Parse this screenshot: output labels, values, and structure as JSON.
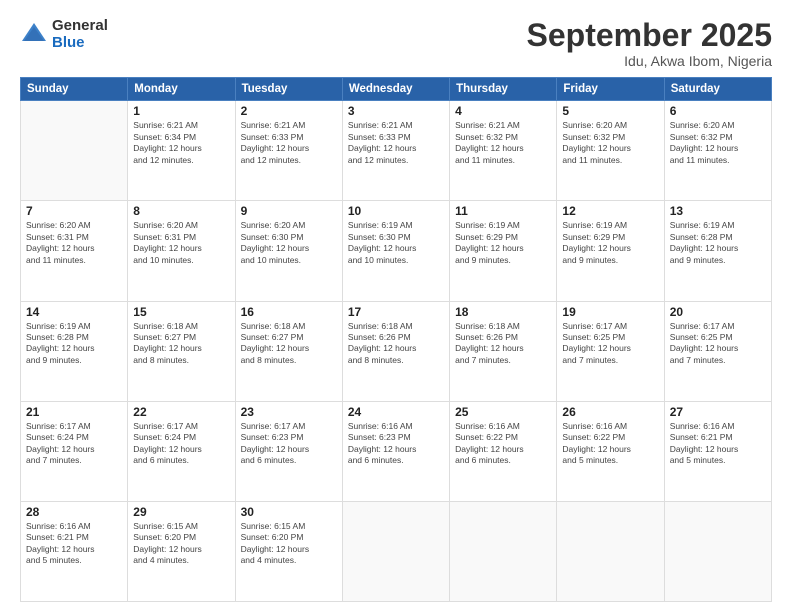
{
  "header": {
    "logo_general": "General",
    "logo_blue": "Blue",
    "month_title": "September 2025",
    "subtitle": "Idu, Akwa Ibom, Nigeria"
  },
  "weekdays": [
    "Sunday",
    "Monday",
    "Tuesday",
    "Wednesday",
    "Thursday",
    "Friday",
    "Saturday"
  ],
  "weeks": [
    [
      {
        "day": "",
        "info": ""
      },
      {
        "day": "1",
        "info": "Sunrise: 6:21 AM\nSunset: 6:34 PM\nDaylight: 12 hours\nand 12 minutes."
      },
      {
        "day": "2",
        "info": "Sunrise: 6:21 AM\nSunset: 6:33 PM\nDaylight: 12 hours\nand 12 minutes."
      },
      {
        "day": "3",
        "info": "Sunrise: 6:21 AM\nSunset: 6:33 PM\nDaylight: 12 hours\nand 12 minutes."
      },
      {
        "day": "4",
        "info": "Sunrise: 6:21 AM\nSunset: 6:32 PM\nDaylight: 12 hours\nand 11 minutes."
      },
      {
        "day": "5",
        "info": "Sunrise: 6:20 AM\nSunset: 6:32 PM\nDaylight: 12 hours\nand 11 minutes."
      },
      {
        "day": "6",
        "info": "Sunrise: 6:20 AM\nSunset: 6:32 PM\nDaylight: 12 hours\nand 11 minutes."
      }
    ],
    [
      {
        "day": "7",
        "info": "Sunrise: 6:20 AM\nSunset: 6:31 PM\nDaylight: 12 hours\nand 11 minutes."
      },
      {
        "day": "8",
        "info": "Sunrise: 6:20 AM\nSunset: 6:31 PM\nDaylight: 12 hours\nand 10 minutes."
      },
      {
        "day": "9",
        "info": "Sunrise: 6:20 AM\nSunset: 6:30 PM\nDaylight: 12 hours\nand 10 minutes."
      },
      {
        "day": "10",
        "info": "Sunrise: 6:19 AM\nSunset: 6:30 PM\nDaylight: 12 hours\nand 10 minutes."
      },
      {
        "day": "11",
        "info": "Sunrise: 6:19 AM\nSunset: 6:29 PM\nDaylight: 12 hours\nand 9 minutes."
      },
      {
        "day": "12",
        "info": "Sunrise: 6:19 AM\nSunset: 6:29 PM\nDaylight: 12 hours\nand 9 minutes."
      },
      {
        "day": "13",
        "info": "Sunrise: 6:19 AM\nSunset: 6:28 PM\nDaylight: 12 hours\nand 9 minutes."
      }
    ],
    [
      {
        "day": "14",
        "info": "Sunrise: 6:19 AM\nSunset: 6:28 PM\nDaylight: 12 hours\nand 9 minutes."
      },
      {
        "day": "15",
        "info": "Sunrise: 6:18 AM\nSunset: 6:27 PM\nDaylight: 12 hours\nand 8 minutes."
      },
      {
        "day": "16",
        "info": "Sunrise: 6:18 AM\nSunset: 6:27 PM\nDaylight: 12 hours\nand 8 minutes."
      },
      {
        "day": "17",
        "info": "Sunrise: 6:18 AM\nSunset: 6:26 PM\nDaylight: 12 hours\nand 8 minutes."
      },
      {
        "day": "18",
        "info": "Sunrise: 6:18 AM\nSunset: 6:26 PM\nDaylight: 12 hours\nand 7 minutes."
      },
      {
        "day": "19",
        "info": "Sunrise: 6:17 AM\nSunset: 6:25 PM\nDaylight: 12 hours\nand 7 minutes."
      },
      {
        "day": "20",
        "info": "Sunrise: 6:17 AM\nSunset: 6:25 PM\nDaylight: 12 hours\nand 7 minutes."
      }
    ],
    [
      {
        "day": "21",
        "info": "Sunrise: 6:17 AM\nSunset: 6:24 PM\nDaylight: 12 hours\nand 7 minutes."
      },
      {
        "day": "22",
        "info": "Sunrise: 6:17 AM\nSunset: 6:24 PM\nDaylight: 12 hours\nand 6 minutes."
      },
      {
        "day": "23",
        "info": "Sunrise: 6:17 AM\nSunset: 6:23 PM\nDaylight: 12 hours\nand 6 minutes."
      },
      {
        "day": "24",
        "info": "Sunrise: 6:16 AM\nSunset: 6:23 PM\nDaylight: 12 hours\nand 6 minutes."
      },
      {
        "day": "25",
        "info": "Sunrise: 6:16 AM\nSunset: 6:22 PM\nDaylight: 12 hours\nand 6 minutes."
      },
      {
        "day": "26",
        "info": "Sunrise: 6:16 AM\nSunset: 6:22 PM\nDaylight: 12 hours\nand 5 minutes."
      },
      {
        "day": "27",
        "info": "Sunrise: 6:16 AM\nSunset: 6:21 PM\nDaylight: 12 hours\nand 5 minutes."
      }
    ],
    [
      {
        "day": "28",
        "info": "Sunrise: 6:16 AM\nSunset: 6:21 PM\nDaylight: 12 hours\nand 5 minutes."
      },
      {
        "day": "29",
        "info": "Sunrise: 6:15 AM\nSunset: 6:20 PM\nDaylight: 12 hours\nand 4 minutes."
      },
      {
        "day": "30",
        "info": "Sunrise: 6:15 AM\nSunset: 6:20 PM\nDaylight: 12 hours\nand 4 minutes."
      },
      {
        "day": "",
        "info": ""
      },
      {
        "day": "",
        "info": ""
      },
      {
        "day": "",
        "info": ""
      },
      {
        "day": "",
        "info": ""
      }
    ]
  ]
}
